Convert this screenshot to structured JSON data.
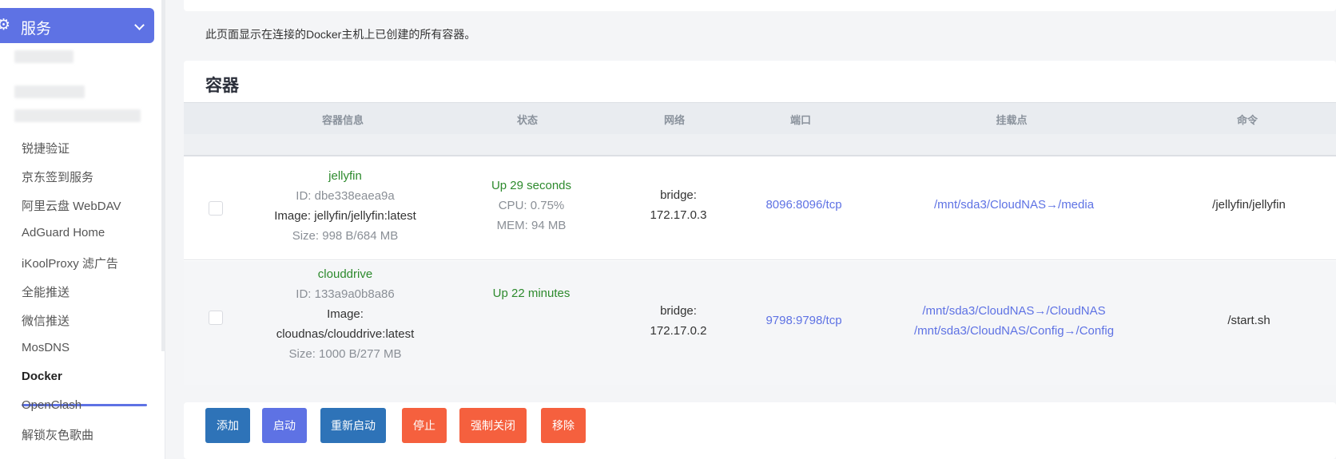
{
  "sidebar": {
    "header_icon": "gear-icon",
    "header_label": "服务",
    "items": [
      {
        "label": "锐捷验证"
      },
      {
        "label": "京东签到服务"
      },
      {
        "label": "阿里云盘 WebDAV"
      },
      {
        "label": "AdGuard Home"
      },
      {
        "label": "iKoolProxy 滤广告"
      },
      {
        "label": "全能推送"
      },
      {
        "label": "微信推送"
      },
      {
        "label": "MosDNS"
      },
      {
        "label": "Docker"
      },
      {
        "label": "OpenClash"
      },
      {
        "label": "解锁灰色歌曲"
      }
    ],
    "active_item": "Docker",
    "accent_color": "#5e72e4"
  },
  "description": "此页面显示在连接的Docker主机上已创建的所有容器。",
  "section_title": "容器",
  "table": {
    "headers": [
      "容器信息",
      "状态",
      "网络",
      "端口",
      "挂载点",
      "命令"
    ],
    "rows": [
      {
        "name": "jellyfin",
        "id": "ID: dbe338eaea9a",
        "image": "Image: jellyfin/jellyfin:latest",
        "size": "Size: 998 B/684 MB",
        "status": "Up 29 seconds",
        "cpu": "CPU: 0.75%",
        "mem": "MEM: 94 MB",
        "network_1": "bridge:",
        "network_2": "172.17.0.3",
        "port": "8096:8096/tcp",
        "mount_1": "/mnt/sda3/CloudNAS→/media",
        "command": "/jellyfin/jellyfin"
      },
      {
        "name": "clouddrive",
        "id": "ID: 133a9a0b8a86",
        "image_1": "Image:",
        "image_2": "cloudnas/clouddrive:latest",
        "size": "Size: 1000 B/277 MB",
        "status": "Up 22 minutes",
        "network_1": "bridge:",
        "network_2": "172.17.0.2",
        "port": "9798:9798/tcp",
        "mount_1": "/mnt/sda3/CloudNAS→/CloudNAS",
        "mount_2": "/mnt/sda3/CloudNAS/Config→/Config",
        "command": "/start.sh"
      }
    ]
  },
  "buttons": {
    "add": "添加",
    "start": "启动",
    "restart": "重新启动",
    "stop": "停止",
    "kill": "强制关闭",
    "remove": "移除"
  },
  "colors": {
    "green_status": "#2d8a2d",
    "link": "#5e72e4",
    "button_blue": "#2e73b8",
    "button_red": "#f5603e"
  }
}
